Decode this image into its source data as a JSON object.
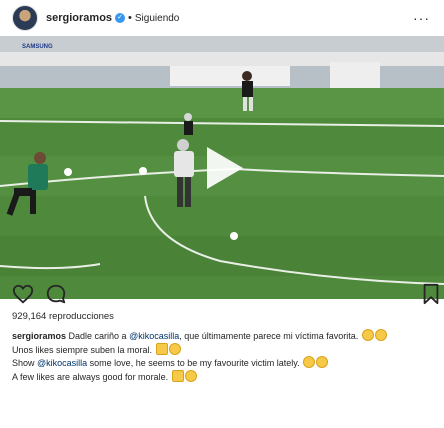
{
  "header": {
    "username": "sergioramos",
    "verified_mark": "✓",
    "separator": "•",
    "follow_status": "Siguiendo",
    "more_icon": "more-horizontal-icon"
  },
  "video": {
    "banner_text": "SAMSUNG",
    "play_icon": "play-icon"
  },
  "actions": {
    "like_icon": "heart-outline-icon",
    "comment_icon": "comment-bubble-icon",
    "save_icon": "bookmark-icon"
  },
  "stats": {
    "views": "929,164 reproducciones"
  },
  "caption": {
    "author": "sergioramos",
    "line1_a": " Dadle cariño a ",
    "mention1": "@kikocasilla",
    "line1_b": ", que últimamente parece mi víctima favorita. ",
    "line2": "Unos likes siempre suben la moral. ",
    "line3_a": "Show ",
    "mention2": "@kikocasilla",
    "line3_b": " some love, he seems to be my favourite victim lately. ",
    "line4": "A few likes are always good for morale. "
  },
  "colors": {
    "verified": "#3897f0",
    "pitch": "#4f8a3c",
    "text": "#262626"
  }
}
